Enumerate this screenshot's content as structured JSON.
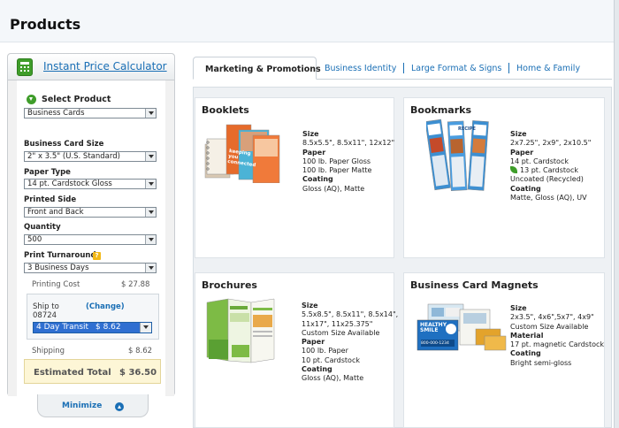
{
  "page": {
    "title": "Products"
  },
  "calculator": {
    "title": "Instant Price Calculator",
    "select_product_label": "Select Product",
    "product_value": "Business Cards",
    "fields": [
      {
        "label": "Business Card Size",
        "value": "2\" x 3.5\" (U.S. Standard)"
      },
      {
        "label": "Paper Type",
        "value": "14 pt. Cardstock Gloss"
      },
      {
        "label": "Printed Side",
        "value": "Front and Back"
      },
      {
        "label": "Quantity",
        "value": "500"
      },
      {
        "label": "Print Turnaround",
        "value": "3 Business Days"
      }
    ],
    "help_glyph": "?",
    "printing_cost_label": "Printing Cost",
    "printing_cost_value": "$ 27.88",
    "ship_to_label": "Ship to",
    "ship_zip": "08724",
    "change_link": "(Change)",
    "transit_value": "4 Day Transit",
    "transit_price": "$ 8.62",
    "shipping_label": "Shipping",
    "shipping_value": "$ 8.62",
    "estimated_total_label": "Estimated Total",
    "estimated_total_value": "$ 36.50",
    "minimize_label": "Minimize"
  },
  "tabs": [
    {
      "label": "Marketing & Promotions",
      "active": true
    },
    {
      "label": "Business Identity",
      "active": false
    },
    {
      "label": "Large Format & Signs",
      "active": false
    },
    {
      "label": "Home & Family",
      "active": false
    }
  ],
  "products": [
    {
      "name": "Booklets",
      "thumb_text": "keeping you connected",
      "specs": [
        {
          "heading": "Size",
          "lines": [
            "8.5x5.5\", 8.5x11\", 12x12\""
          ]
        },
        {
          "heading": "Paper",
          "lines": [
            "100 lb. Paper Gloss",
            "100 lb. Paper Matte"
          ]
        },
        {
          "heading": "Coating",
          "lines": [
            "Gloss (AQ), Matte"
          ]
        }
      ]
    },
    {
      "name": "Bookmarks",
      "thumb_text": "RECIPE",
      "specs": [
        {
          "heading": "Size",
          "lines": [
            "2x7.25\", 2x9\", 2x10.5\""
          ]
        },
        {
          "heading": "Paper",
          "lines": [
            "14 pt. Cardstock",
            "13 pt. Cardstock",
            "Uncoated (Recycled)"
          ]
        },
        {
          "heading": "Coating",
          "lines": [
            "Matte, Gloss (AQ), UV"
          ]
        }
      ]
    },
    {
      "name": "Brochures",
      "thumb_text": "",
      "specs": [
        {
          "heading": "Size",
          "lines": [
            "5.5x8.5\", 8.5x11\", 8.5x14\",",
            "11x17\", 11x25.375\"",
            "Custom Size Available"
          ]
        },
        {
          "heading": "Paper",
          "lines": [
            "100 lb. Paper",
            "10 pt. Cardstock"
          ]
        },
        {
          "heading": "Coating",
          "lines": [
            "Gloss (AQ), Matte"
          ]
        }
      ]
    },
    {
      "name": "Business Card Magnets",
      "thumb_text": "HEALTHY SMILE",
      "thumb_phone": "800-000-1234",
      "specs": [
        {
          "heading": "Size",
          "lines": [
            "2x3.5\", 4x6\",5x7\", 4x9\"",
            "Custom Size Available"
          ]
        },
        {
          "heading": "Material",
          "lines": [
            "17 pt. magnetic Cardstock"
          ]
        },
        {
          "heading": "Coating",
          "lines": [
            "Bright semi-gloss"
          ]
        }
      ]
    }
  ],
  "colors": {
    "link": "#1a6fb5",
    "accent_green": "#3f9d2a",
    "total_bg": "#fdf6d6"
  }
}
